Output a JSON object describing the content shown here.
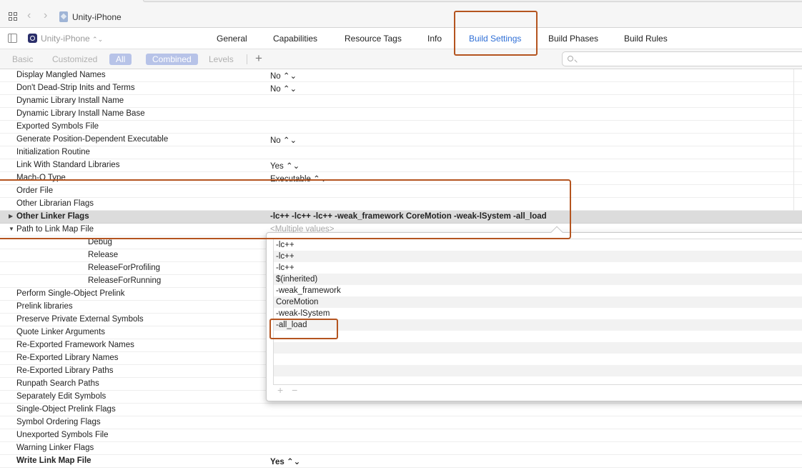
{
  "breadcrumb": {
    "project": "Unity-iPhone"
  },
  "target": {
    "name": "Unity-iPhone",
    "stepper": "⌃⌄"
  },
  "tabs": [
    {
      "label": "General"
    },
    {
      "label": "Capabilities"
    },
    {
      "label": "Resource Tags"
    },
    {
      "label": "Info"
    },
    {
      "label": "Build Settings"
    },
    {
      "label": "Build Phases"
    },
    {
      "label": "Build Rules"
    }
  ],
  "filters": {
    "basic": "Basic",
    "customized": "Customized",
    "all": "All",
    "combined": "Combined",
    "levels": "Levels",
    "add": "+"
  },
  "search": {
    "placeholder": ""
  },
  "rows": [
    {
      "name": "Display Mangled Names",
      "value": "No ⌃⌄"
    },
    {
      "name": "Don't Dead-Strip Inits and Terms",
      "value": "No ⌃⌄"
    },
    {
      "name": "Dynamic Library Install Name",
      "value": ""
    },
    {
      "name": "Dynamic Library Install Name Base",
      "value": ""
    },
    {
      "name": "Exported Symbols File",
      "value": ""
    },
    {
      "name": "Generate Position-Dependent Executable",
      "value": "No ⌃⌄"
    },
    {
      "name": "Initialization Routine",
      "value": ""
    },
    {
      "name": "Link With Standard Libraries",
      "value": "Yes ⌃⌄"
    },
    {
      "name": "Mach-O Type",
      "value": "Executable ⌃⌄"
    },
    {
      "name": "Order File",
      "value": ""
    },
    {
      "name": "Other Librarian Flags",
      "value": ""
    },
    {
      "name": "Other Linker Flags",
      "value": "-lc++ -lc++ -lc++  -weak_framework CoreMotion -weak-lSystem -all_load"
    },
    {
      "name": "Path to Link Map File",
      "value": "<Multiple values>"
    },
    {
      "name": "Debug",
      "value": ""
    },
    {
      "name": "Release",
      "value": ""
    },
    {
      "name": "ReleaseForProfiling",
      "value": ""
    },
    {
      "name": "ReleaseForRunning",
      "value": ""
    },
    {
      "name": "Perform Single-Object Prelink",
      "value": ""
    },
    {
      "name": "Prelink libraries",
      "value": ""
    },
    {
      "name": "Preserve Private External Symbols",
      "value": ""
    },
    {
      "name": "Quote Linker Arguments",
      "value": ""
    },
    {
      "name": "Re-Exported Framework Names",
      "value": ""
    },
    {
      "name": "Re-Exported Library Names",
      "value": ""
    },
    {
      "name": "Re-Exported Library Paths",
      "value": ""
    },
    {
      "name": "Runpath Search Paths",
      "value": ""
    },
    {
      "name": "Separately Edit Symbols",
      "value": ""
    },
    {
      "name": "Single-Object Prelink Flags",
      "value": ""
    },
    {
      "name": "Symbol Ordering Flags",
      "value": ""
    },
    {
      "name": "Unexported Symbols File",
      "value": ""
    },
    {
      "name": "Warning Linker Flags",
      "value": ""
    },
    {
      "name": "Write Link Map File",
      "value": "Yes ⌃⌄"
    }
  ],
  "popover": {
    "items": [
      "-lc++",
      "-lc++",
      "-lc++",
      "$(inherited)",
      "-weak_framework",
      "CoreMotion",
      "-weak-lSystem",
      "-all_load"
    ],
    "add": "+",
    "remove": "−"
  },
  "colors": {
    "accent": "#2f6fd6",
    "annotation": "#b4541f",
    "selected_row": "#dcdcdc"
  }
}
